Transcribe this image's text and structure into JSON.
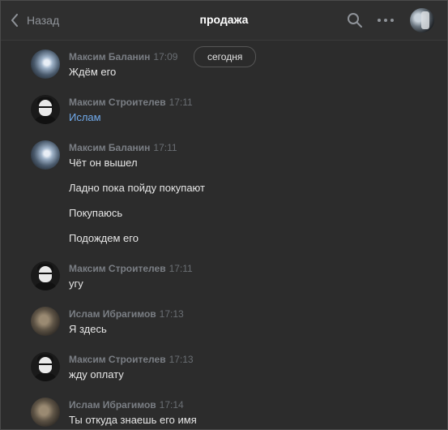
{
  "header": {
    "back_label": "Назад",
    "title": "продажа",
    "icons": [
      "search-icon",
      "more-icon",
      "chat-avatar"
    ]
  },
  "date_separator": "сегодня",
  "colors": {
    "background": "#2c2c2c",
    "header": "#2f2f2f",
    "link": "#71aaeb",
    "name": "#7a7e84",
    "text": "#e6e6e6"
  },
  "messages": [
    {
      "author": "Максим Баланин",
      "time": "17:09",
      "avatar": "maxim-balanin",
      "lines": [
        "Ждём его"
      ]
    },
    {
      "author": "Максим Строителев",
      "time": "17:11",
      "avatar": "maxim-stroitelev",
      "lines": [
        "Ислам"
      ]
    },
    {
      "author": "Максим Баланин",
      "time": "17:11",
      "avatar": "maxim-balanin",
      "lines": [
        "Чёт он вышел",
        "Ладно пока пойду покупают",
        "Покупаюсь",
        "Подождем его"
      ]
    },
    {
      "author": "Максим Строителев",
      "time": "17:11",
      "avatar": "maxim-stroitelev",
      "lines": [
        "угу"
      ]
    },
    {
      "author": "Ислам Ибрагимов",
      "time": "17:13",
      "avatar": "islam-ibragimov",
      "lines": [
        "Я здесь"
      ]
    },
    {
      "author": "Максим Строителев",
      "time": "17:13",
      "avatar": "maxim-stroitelev",
      "lines": [
        "жду оплату"
      ]
    },
    {
      "author": "Ислам Ибрагимов",
      "time": "17:14",
      "avatar": "islam-ibragimov",
      "lines": [
        "Ты откуда знаешь его имя"
      ]
    }
  ]
}
